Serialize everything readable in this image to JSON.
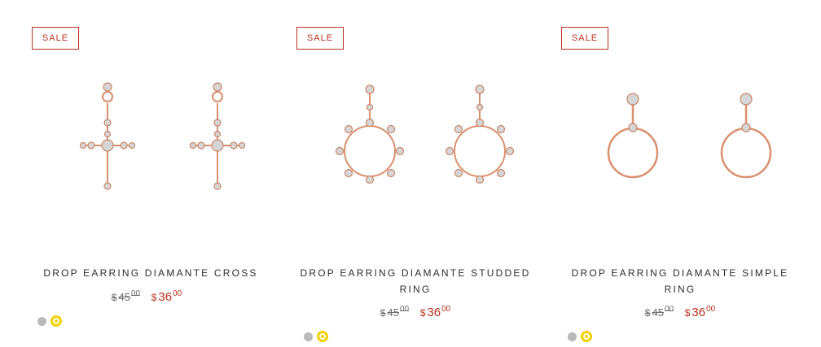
{
  "products": [
    {
      "badge": "SALE",
      "title": "DROP EARRING DIAMANTE CROSS",
      "price_currency": "$",
      "old_price_whole": "45",
      "old_price_cents": "00",
      "new_price_whole": "36",
      "new_price_cents": "00",
      "swatches": [
        "silver",
        "gold"
      ],
      "selected_swatch": "gold",
      "image_icon": "cross-earrings-image"
    },
    {
      "badge": "SALE",
      "title": "DROP EARRING DIAMANTE STUDDED RING",
      "price_currency": "$",
      "old_price_whole": "45",
      "old_price_cents": "00",
      "new_price_whole": "36",
      "new_price_cents": "00",
      "swatches": [
        "silver",
        "gold"
      ],
      "selected_swatch": "gold",
      "image_icon": "studded-ring-earrings-image"
    },
    {
      "badge": "SALE",
      "title": "DROP EARRING DIAMANTE SIMPLE RING",
      "price_currency": "$",
      "old_price_whole": "45",
      "old_price_cents": "00",
      "new_price_whole": "36",
      "new_price_cents": "00",
      "swatches": [
        "silver",
        "gold"
      ],
      "selected_swatch": "gold",
      "image_icon": "simple-ring-earrings-image"
    }
  ],
  "colors": {
    "sale_accent": "#b8321f",
    "rose_gold": "#d9906f",
    "swatch_silver": "#b9b9b9",
    "swatch_gold": "#f5d000"
  }
}
